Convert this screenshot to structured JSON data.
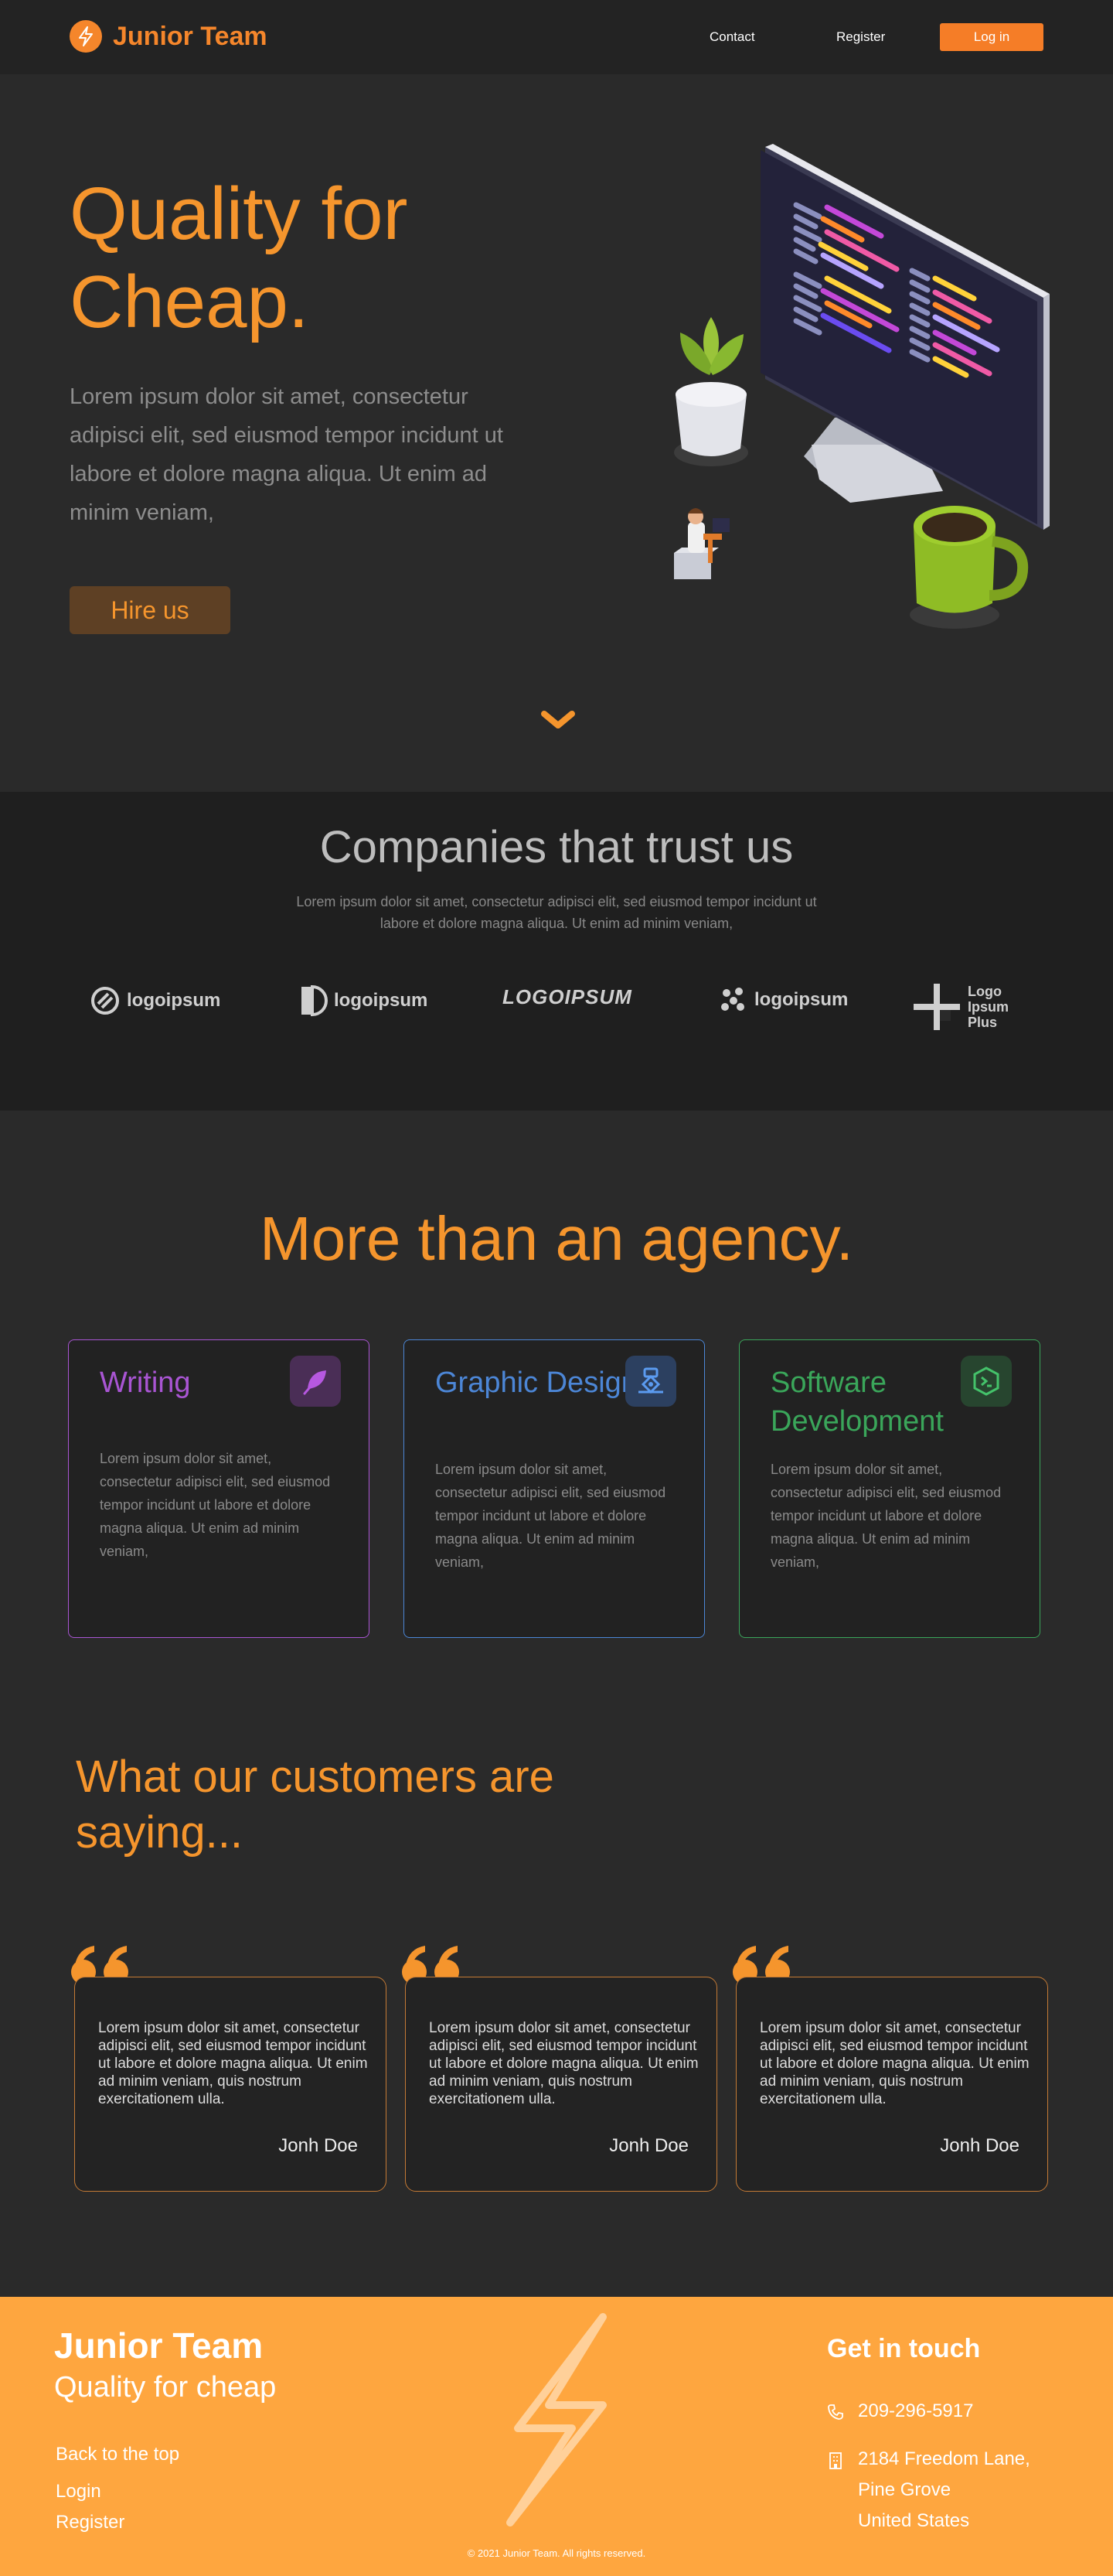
{
  "nav": {
    "brand": "Junior Team",
    "links": [
      "Contact",
      "Register"
    ],
    "login": "Log in"
  },
  "hero": {
    "title_line1": "Quality for",
    "title_line2": "Cheap.",
    "text": "Lorem ipsum dolor sit amet, consectetur adipisci elit, sed eiusmod tempor incidunt ut labore et dolore magna aliqua. Ut enim ad minim veniam,",
    "cta": "Hire us"
  },
  "companies": {
    "title": "Companies that trust us",
    "text": "Lorem ipsum dolor sit amet, consectetur adipisci elit, sed eiusmod tempor incidunt ut labore et dolore magna aliqua. Ut enim ad minim veniam,",
    "logos": [
      "logoipsum",
      "logoipsum",
      "LOGOIPSUM",
      "logoipsum",
      "Logo Ipsum Plus"
    ]
  },
  "agency": {
    "title": "More than an agency.",
    "cards": [
      {
        "title": "Writing",
        "text": "Lorem ipsum dolor sit amet, consectetur adipisci elit, sed eiusmod tempor incidunt ut labore et dolore magna aliqua. Ut enim ad minim veniam,",
        "color": "#a955d3"
      },
      {
        "title": "Graphic Design",
        "text": "Lorem ipsum dolor sit amet, consectetur adipisci elit, sed eiusmod tempor incidunt ut labore et dolore magna aliqua. Ut enim ad minim veniam,",
        "color": "#4c86d6"
      },
      {
        "title": "Software Development",
        "text": "Lorem ipsum dolor sit amet, consectetur adipisci elit, sed eiusmod tempor incidunt ut labore et dolore magna aliqua. Ut enim ad minim veniam,",
        "color": "#3aa65a"
      }
    ]
  },
  "testimonials": {
    "title": "What our customers are saying...",
    "items": [
      {
        "text": "Lorem ipsum dolor sit amet, consectetur adipisci elit, sed eiusmod tempor incidunt ut labore et dolore magna aliqua. Ut enim ad minim veniam, quis nostrum exercitationem ulla.",
        "author": "Jonh Doe"
      },
      {
        "text": "Lorem ipsum dolor sit amet, consectetur adipisci elit, sed eiusmod tempor incidunt ut labore et dolore magna aliqua. Ut enim ad minim veniam, quis nostrum exercitationem ulla.",
        "author": "Jonh Doe"
      },
      {
        "text": "Lorem ipsum dolor sit amet, consectetur adipisci elit, sed eiusmod tempor incidunt ut labore et dolore magna aliqua. Ut enim ad minim veniam, quis nostrum exercitationem ulla.",
        "author": "Jonh Doe"
      }
    ]
  },
  "footer": {
    "name": "Junior Team",
    "tagline": "Quality for cheap",
    "links": [
      "Back to the top",
      "Login",
      "Register"
    ],
    "touch_title": "Get in touch",
    "phone": "209-296-5917",
    "address_line1": "2184  Freedom Lane,",
    "address_line2": "Pine Grove",
    "address_line3": "United States",
    "copyright": "© 2021 Junior Team. All rights reserved."
  },
  "colors": {
    "accent": "#f5952d",
    "background": "#2a2a2a",
    "footer": "#fea63f"
  }
}
